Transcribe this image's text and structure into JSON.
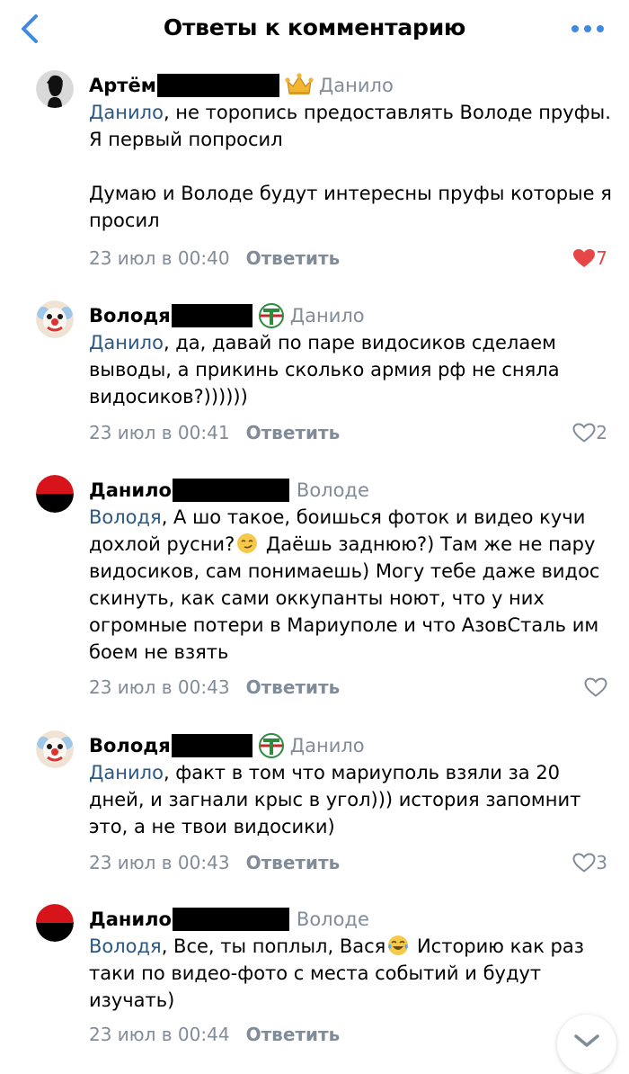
{
  "header": {
    "title": "Ответы к комментарию",
    "back_icon": "chevron-left-icon",
    "more_icon": "more-horizontal-icon",
    "accent": "#3f8ae0"
  },
  "reply_label": "Ответить",
  "comments": [
    {
      "author": "Артём",
      "reply_to": "Данило",
      "badge_icon": "crown-icon",
      "avatar_icon": "silhouette-avatar",
      "mention": "Данило",
      "text_1": ", не торопись предоставлять Володе пруфы. Я первый попросил",
      "text_2": "Думаю и Володе будут интересны пруфы которые я просил",
      "date": "23 июл в 00:40",
      "likes": "7",
      "liked": true
    },
    {
      "author": "Володя",
      "reply_to": "Данило",
      "badge_icon": "torpedo-logo-icon",
      "avatar_icon": "clown-avatar",
      "mention": "Данило",
      "text_1": ", да, давай по паре видосиков сделаем выводы, а прикинь сколько армия рф не сняла видосиков?))))))",
      "date": "23 июл в 00:41",
      "likes": "2",
      "liked": false
    },
    {
      "author": "Данило",
      "reply_to": "Володе",
      "avatar_icon": "red-black-flag-avatar",
      "mention": "Володя",
      "text_1": ", А шо такое, боишься фоток и видео кучи дохлой русни?",
      "emoji": "smirk-emoji",
      "text_2": " Даёшь заднюю?) Там же не пару видосиков, сам понимаешь) Могу тебе даже видос скинуть, как сами оккупанты ноют, что у них огромные потери в Мариуполе и что АзовСталь им боем не взять",
      "date": "23 июл в 00:43",
      "likes": "",
      "liked": false
    },
    {
      "author": "Володя",
      "reply_to": "Данило",
      "badge_icon": "torpedo-logo-icon",
      "avatar_icon": "clown-avatar",
      "mention": "Данило",
      "text_1": ", факт в том что мариуполь взяли за 20 дней, и загнали крыс в угол))) история запомнит это, а не твои видосики)",
      "date": "23 июл в 00:43",
      "likes": "3",
      "liked": false
    },
    {
      "author": "Данило",
      "reply_to": "Володе",
      "avatar_icon": "red-black-flag-avatar",
      "mention": "Володя",
      "text_1": ", Все, ты поплыл, Вася",
      "emoji": "tears-of-joy-emoji",
      "text_2": " Историю как раз таки по видео-фото с места событий и будут изучать)",
      "date": "23 июл в 00:44",
      "likes": "",
      "liked": false
    }
  ],
  "scroll_down_icon": "chevron-down-icon"
}
